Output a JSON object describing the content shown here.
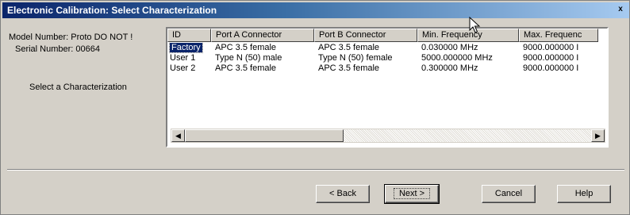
{
  "window": {
    "title": "Electronic Calibration: Select Characterization",
    "close_glyph": "x"
  },
  "info": {
    "model": "Model Number: Proto DO NOT !",
    "serial": "Serial Number: 00664",
    "select_label": "Select a Characterization"
  },
  "table": {
    "columns": [
      "ID",
      "Port A Connector",
      "Port B Connector",
      "Min. Frequency",
      "Max. Frequenc"
    ],
    "rows": [
      [
        "Factory",
        "APC 3.5 female",
        "APC 3.5 female",
        "0.030000 MHz",
        "9000.000000 I"
      ],
      [
        "User 1",
        "Type N (50) male",
        "Type N (50) female",
        "5000.000000 MHz",
        "9000.000000 I"
      ],
      [
        "User 2",
        "APC 3.5 female",
        "APC 3.5 female",
        "0.300000 MHz",
        "9000.000000 I"
      ]
    ],
    "selected_row": 0
  },
  "buttons": {
    "back": "< Back",
    "next": "Next >",
    "cancel": "Cancel",
    "help": "Help"
  }
}
